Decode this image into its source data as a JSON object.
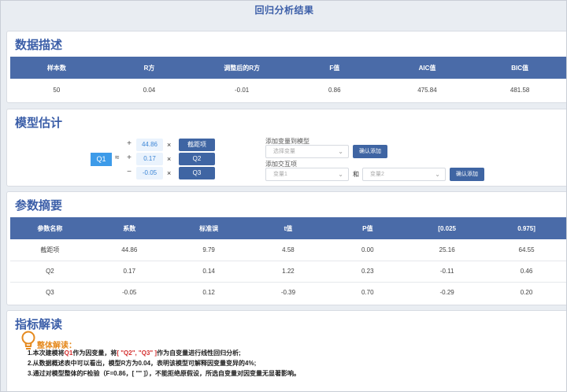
{
  "page_title": "回归分析结果",
  "sections": {
    "data_description": {
      "title": "数据描述",
      "headers": [
        "样本数",
        "R方",
        "调整后的R方",
        "F值",
        "AIC值",
        "BIC值"
      ],
      "row": [
        "50",
        "0.04",
        "-0.01",
        "0.86",
        "475.84",
        "481.58"
      ]
    },
    "model_estimate": {
      "title": "模型估计",
      "dependent": "Q1",
      "approx": "≈",
      "times": "×",
      "terms": [
        {
          "sign": "+",
          "coef": "44.86",
          "var": "截距项"
        },
        {
          "sign": "+",
          "coef": "0.17",
          "var": "Q2"
        },
        {
          "sign": "−",
          "coef": "-0.05",
          "var": "Q3"
        }
      ],
      "add_var_label": "添加变量到模型",
      "select_var_placeholder": "选择变量",
      "confirm_add": "确认添加",
      "add_interaction_label": "添加交互项",
      "var1_placeholder": "变量1",
      "and_label": "和",
      "var2_placeholder": "变量2",
      "confirm_add2": "确认添加"
    },
    "param_summary": {
      "title": "参数摘要",
      "headers": [
        "参数名称",
        "系数",
        "标准误",
        "t值",
        "P值",
        "[0.025",
        "0.975]"
      ],
      "rows": [
        [
          "截距项",
          "44.86",
          "9.79",
          "4.58",
          "0.00",
          "25.16",
          "64.55"
        ],
        [
          "Q2",
          "0.17",
          "0.14",
          "1.22",
          "0.23",
          "-0.11",
          "0.46"
        ],
        [
          "Q3",
          "-0.05",
          "0.12",
          "-0.39",
          "0.70",
          "-0.29",
          "0.20"
        ]
      ]
    },
    "interpretation": {
      "title": "指标解读",
      "overall_title": "整体解读：",
      "line1_a": "1.本次建模将",
      "line1_dep": "Q1",
      "line1_b": "作为因变量，将",
      "line1_indep": "[ \"Q2\", \"Q3\" ]",
      "line1_c": "作为自变量进行线性回归分析;",
      "line2": "2.从数据概述表中可以看出，模型R方为0.04，表明该模型可解释因变量变异的4%;",
      "line3": "3.通过对模型整体的F检验（F=0.86，[ \"\" ]），不能拒绝原假设，所选自变量对因变量无显著影响。"
    }
  },
  "colors": {
    "accent": "#3b5ea8",
    "header_bg": "#4a6ba8",
    "button": "#3f65a3",
    "highlight": "#3d9be9",
    "warning": "#e58a1f",
    "red": "#d42f2f"
  }
}
